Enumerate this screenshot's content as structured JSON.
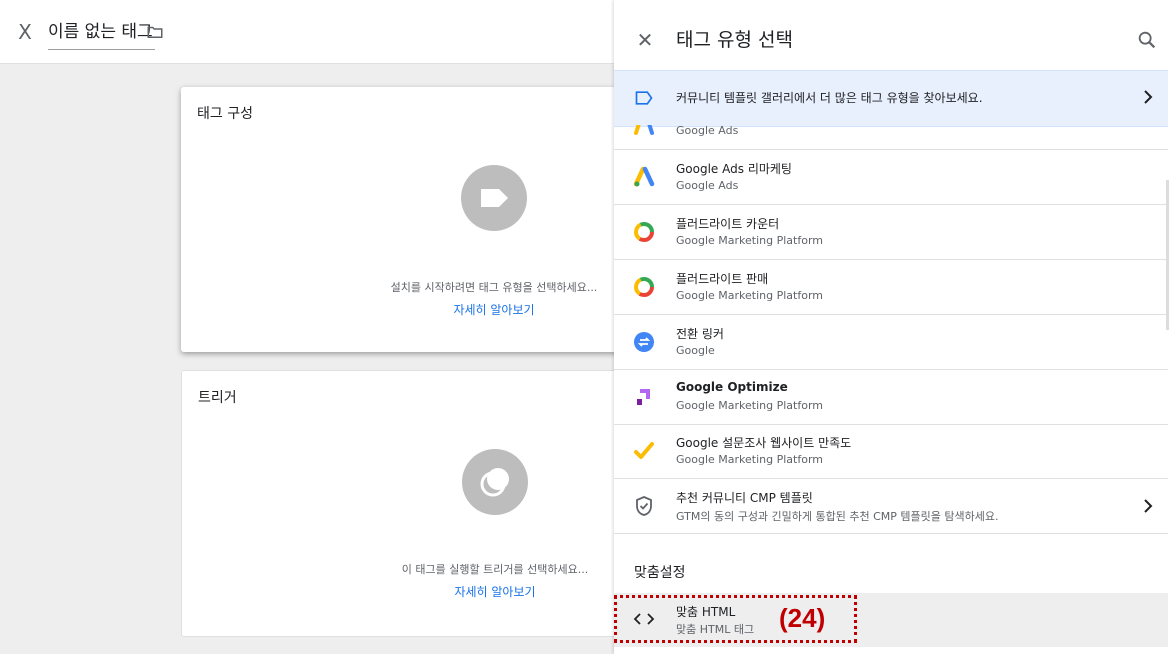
{
  "left": {
    "close_glyph": "X",
    "title": "이름 없는 태그",
    "tag_card": {
      "title": "태그 구성",
      "hint": "설치를 시작하려면 태그 유형을 선택하세요...",
      "link": "자세히 알아보기"
    },
    "trigger_card": {
      "title": "트리거",
      "hint": "이 태그를 실행할 트리거를 선택하세요...",
      "link": "자세히 알아보기"
    }
  },
  "panel": {
    "close_glyph": "✕",
    "title": "태그 유형 선택",
    "banner_text": "커뮤니티 템플릿 갤러리에서 더 많은 태그 유형을 찾아보세요.",
    "partial_item_sub": "Google Ads",
    "items": [
      {
        "title": "Google Ads 리마케팅",
        "subtitle": "Google Ads",
        "icon": "google-ads-icon",
        "chevron": false
      },
      {
        "title": "플러드라이트 카운터",
        "subtitle": "Google Marketing Platform",
        "icon": "floodlight-icon",
        "chevron": false
      },
      {
        "title": "플러드라이트 판매",
        "subtitle": "Google Marketing Platform",
        "icon": "floodlight-icon",
        "chevron": false
      },
      {
        "title": "전환 링커",
        "subtitle": "Google",
        "icon": "conversion-linker-icon",
        "chevron": false
      },
      {
        "title": "Google Optimize",
        "subtitle": "Google Marketing Platform",
        "icon": "optimize-icon",
        "chevron": false
      },
      {
        "title": "Google 설문조사 웹사이트 만족도",
        "subtitle": "Google Marketing Platform",
        "icon": "surveys-icon",
        "chevron": false
      },
      {
        "title": "추천 커뮤니티 CMP 템플릿",
        "subtitle": "GTM의 동의 구성과 긴밀하게 통합된 추천 CMP 템플릿을 탐색하세요.",
        "icon": "shield-check-icon",
        "chevron": true
      }
    ],
    "custom_heading": "맞춤설정",
    "custom_html": {
      "title": "맞춤 HTML",
      "subtitle": "맞춤 HTML 태그"
    }
  },
  "annotation": {
    "step": "(24)",
    "color": "#c00000"
  },
  "colors": {
    "accent": "#1a73e8",
    "banner_bg": "#e8f0fe",
    "selected_row": "#eeeeee"
  }
}
